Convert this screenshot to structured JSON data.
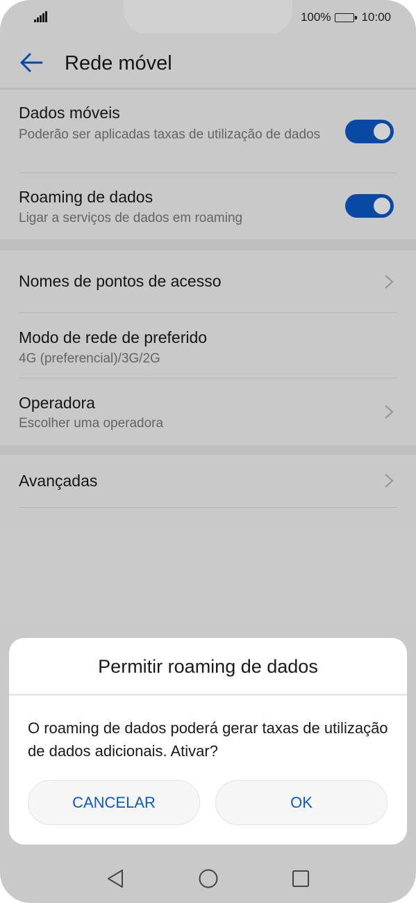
{
  "status_bar": {
    "battery_percent": "100%",
    "time": "10:00"
  },
  "header": {
    "title": "Rede móvel"
  },
  "sections": [
    {
      "items": [
        {
          "title": "Dados móveis",
          "subtitle": "Poderão ser aplicadas taxas de utilização de dados",
          "control": "toggle",
          "state": "on"
        },
        {
          "title": "Roaming de dados",
          "subtitle": "Ligar a serviços de dados em roaming",
          "control": "toggle",
          "state": "on"
        }
      ]
    },
    {
      "items": [
        {
          "title": "Nomes de pontos de acesso",
          "control": "chevron"
        },
        {
          "title": "Modo de rede de preferido",
          "subtitle": "4G (preferencial)/3G/2G"
        },
        {
          "title": "Operadora",
          "subtitle": "Escolher uma operadora",
          "control": "chevron"
        }
      ]
    },
    {
      "items": [
        {
          "title": "Avançadas",
          "control": "chevron"
        }
      ]
    }
  ],
  "dialog": {
    "title": "Permitir roaming de dados",
    "message": "O roaming de dados poderá gerar taxas de utilização de dados adicionais. Ativar?",
    "cancel_label": "CANCELAR",
    "ok_label": "OK"
  },
  "colors": {
    "accent": "#0a59c8",
    "background": "#f6f6f6"
  },
  "icons": {
    "back": "back-arrow-icon",
    "chevron": "chevron-right-icon",
    "nav_back": "triangle-back-icon",
    "nav_home": "circle-home-icon",
    "nav_recent": "square-recent-icon"
  }
}
